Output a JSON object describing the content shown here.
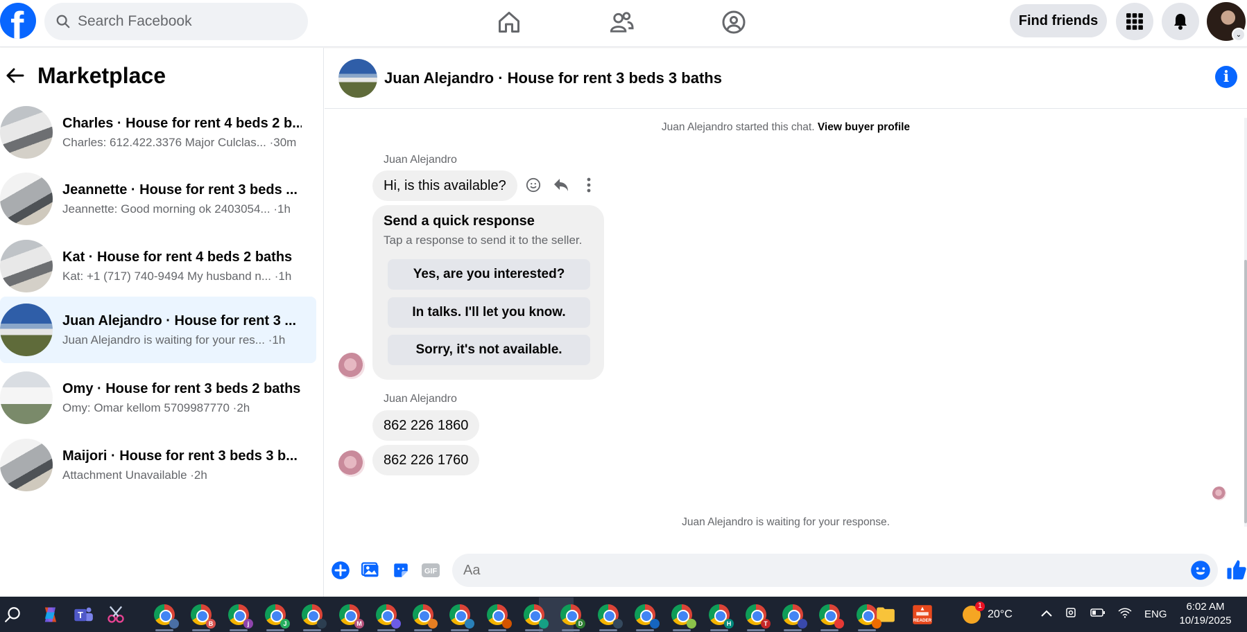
{
  "topbar": {
    "search_placeholder": "Search Facebook",
    "find_friends_label": "Find friends"
  },
  "sidebar": {
    "title": "Marketplace",
    "conversations": [
      {
        "name": "Charles · House for rent 4 beds 2 b...",
        "snippet": "Charles: 612.422.3376 Major Culclas... ·30m",
        "active": false
      },
      {
        "name": "Jeannette · House for rent 3 beds ...",
        "snippet": "Jeannette: Good morning ok 2403054... ·1h",
        "active": false
      },
      {
        "name": "Kat · House for rent 4 beds 2 baths",
        "snippet": "Kat: +1 (717) 740-9494 My husband n... ·1h",
        "active": false
      },
      {
        "name": "Juan Alejandro · House for rent 3 ...",
        "snippet": "Juan Alejandro is waiting for your res...  ·1h",
        "active": true
      },
      {
        "name": "Omy · House for rent 3 beds 2 baths",
        "snippet": "Omy: Omar kellom 5709987770 ·2h",
        "active": false
      },
      {
        "name": "Maijori · House for rent 3 beds 3 b...",
        "snippet": "Attachment Unavailable ·2h",
        "active": false
      }
    ]
  },
  "chat": {
    "title": "Juan Alejandro · House for rent 3 beds 3 baths",
    "started_text": "Juan Alejandro started this chat.",
    "view_profile_label": "View buyer profile",
    "sender_name_1": "Juan Alejandro",
    "message_1": "Hi, is this available?",
    "quick_title": "Send a quick response",
    "quick_subtitle": "Tap a response to send it to the seller.",
    "quick_responses": [
      "Yes, are you interested?",
      "In talks. I'll let you know.",
      "Sorry, it's not available."
    ],
    "sender_name_2": "Juan Alejandro",
    "message_2": "862 226 1860",
    "message_3": "862 226 1760",
    "waiting_text": "Juan Alejandro is waiting for your response.",
    "composer_placeholder": "Aa",
    "gif_label": "GIF"
  },
  "taskbar": {
    "temperature": "20°C",
    "weather_badge": "1",
    "language": "ENG",
    "time": "6:02 AM",
    "date": "10/19/2025",
    "chrome_profiles": [
      "",
      "B",
      "j",
      "J",
      "",
      "M",
      "",
      "",
      "",
      "",
      "",
      "D",
      "",
      "",
      "",
      "H",
      "T",
      "",
      "",
      ""
    ]
  },
  "colors": {
    "brand_blue": "#0866ff",
    "active_row": "#ebf5ff",
    "taskbar_bg": "#1c2331"
  }
}
